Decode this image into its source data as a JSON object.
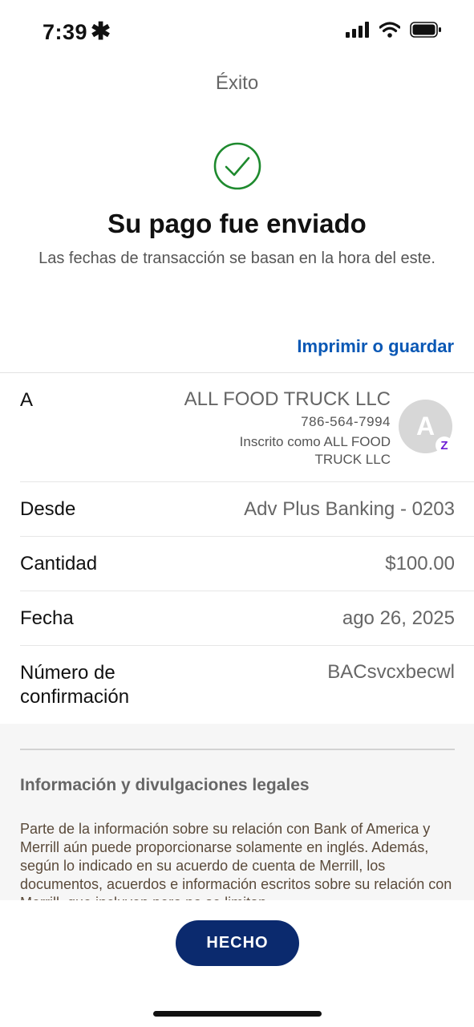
{
  "status_bar": {
    "time": "7:39",
    "icons": [
      "signal-icon",
      "wifi-icon",
      "battery-icon"
    ]
  },
  "nav": {
    "title": "Éxito"
  },
  "success": {
    "icon": "checkmark-circle-icon",
    "icon_color": "#1e8a2e",
    "headline": "Su pago fue enviado",
    "subtitle": "Las fechas de transacción se basan en la hora del este."
  },
  "actions": {
    "print_save": "Imprimir o guardar"
  },
  "details": {
    "recipient": {
      "label": "A",
      "name": "ALL FOOD TRUCK LLC",
      "phone": "786-564-7994",
      "enrolled_as": "Inscrito como ALL FOOD TRUCK LLC",
      "avatar_initial": "A",
      "badge_letter": "Z"
    },
    "from": {
      "label": "Desde",
      "value": "Adv Plus Banking - 0203"
    },
    "amount": {
      "label": "Cantidad",
      "value": "$100.00"
    },
    "date": {
      "label": "Fecha",
      "value": "ago 26, 2025"
    },
    "confirmation": {
      "label": "Número de confirmación",
      "value": "BACsvcxbecwl"
    }
  },
  "legal": {
    "heading": "Información y divulgaciones legales",
    "body": "Parte de la información sobre su relación con Bank of America y Merrill aún puede proporcionarse solamente en inglés. Además, según lo indicado en su acuerdo de cuenta de Merrill, los documentos, acuerdos e información escritos sobre su relación con Merrill, que incluyen pero no se limitan"
  },
  "footer": {
    "done_label": "HECHO"
  },
  "colors": {
    "link": "#0a58b5",
    "primary_button": "#0b2a6e",
    "zelle_purple": "#6d1ed4"
  }
}
